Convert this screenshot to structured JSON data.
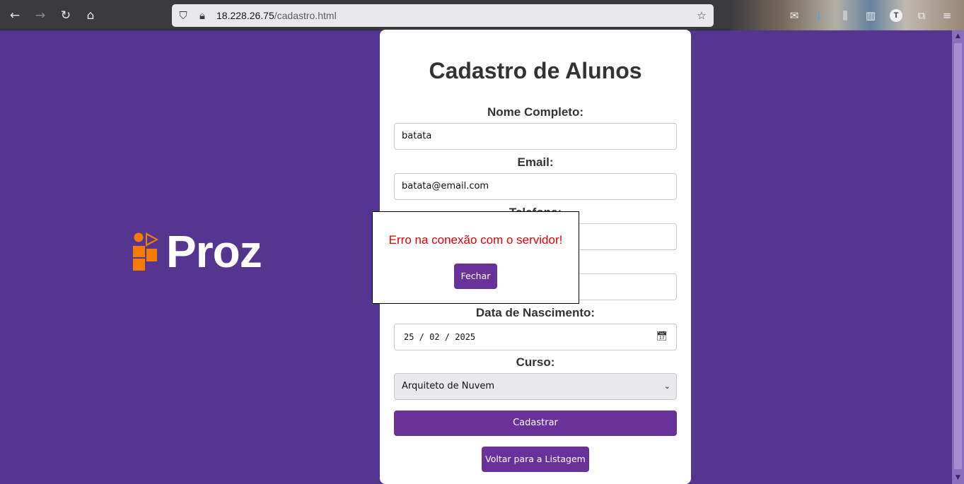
{
  "browser": {
    "url_host": "18.228.26.75",
    "url_path": "/cadastro.html",
    "avatar_letter": "T",
    "icons": [
      "back-arrow-icon",
      "forward-arrow-icon",
      "reload-icon",
      "home-icon",
      "shield-icon",
      "lock-icon",
      "bookmark-star-icon",
      "mail-icon",
      "download-icon",
      "library-icon",
      "sidebar-icon",
      "extensions-icon",
      "menu-icon"
    ]
  },
  "logo": {
    "text": "Proz",
    "accent_color": "#f57c00"
  },
  "form": {
    "title": "Cadastro de Alunos",
    "fields": {
      "nome": {
        "label": "Nome Completo:",
        "value": "batata"
      },
      "email": {
        "label": "Email:",
        "value": "batata@email.com"
      },
      "telefone": {
        "label": "Telefone:",
        "value": ""
      },
      "hidden_field": {
        "value": ""
      },
      "nascimento": {
        "label": "Data de Nascimento:",
        "value": "25 / 02 / 2025"
      },
      "curso": {
        "label": "Curso:",
        "value": "Arquiteto de Nuvem"
      }
    },
    "submit_label": "Cadastrar",
    "back_label": "Voltar para a Listagem"
  },
  "modal": {
    "message": "Erro na conexão com o servidor!",
    "close_label": "Fechar"
  },
  "colors": {
    "background": "#563591",
    "button": "#69329a",
    "error_text": "#e00000"
  }
}
